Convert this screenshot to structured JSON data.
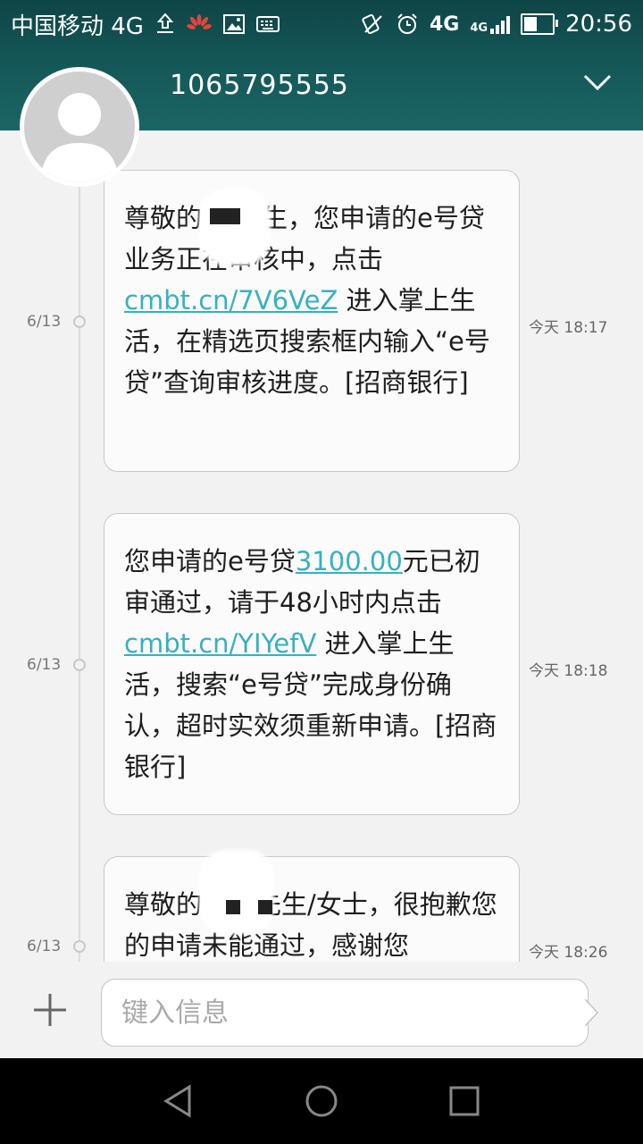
{
  "status_bar": {
    "carrier": "中国移动 4G",
    "net_type": "4G",
    "net_type_small": "4G",
    "time": "20:56"
  },
  "conversation": {
    "contact_number": "1065795555"
  },
  "messages": [
    {
      "date": "6/13",
      "time": "今天 18:17",
      "parts": [
        "尊敬的",
        "先生，您申请的e号贷业务正在审核中，点击 ",
        "cmbt.cn/7V6VeZ",
        " 进入掌上生活，在精选页搜索框内输入“e号贷”查询审核进度。[招商银行]"
      ]
    },
    {
      "date": "6/13",
      "time": "今天 18:18",
      "parts": [
        "您申请的e号贷",
        "3100.00",
        "元已初审通过，请于48小时内点击",
        "cmbt.cn/YIYefV",
        " 进入掌上生活，搜索“e号贷”完成身份确认，超时实效须重新申请。[招商银行]"
      ]
    },
    {
      "date": "6/13",
      "time": "今天 18:26",
      "parts": [
        "尊敬的",
        "先生/女士，很抱歉您的申请未能通过，感谢您"
      ]
    }
  ],
  "compose": {
    "placeholder": "键入信息"
  },
  "colors": {
    "header": "#15595a",
    "link": "#36b1bf"
  }
}
